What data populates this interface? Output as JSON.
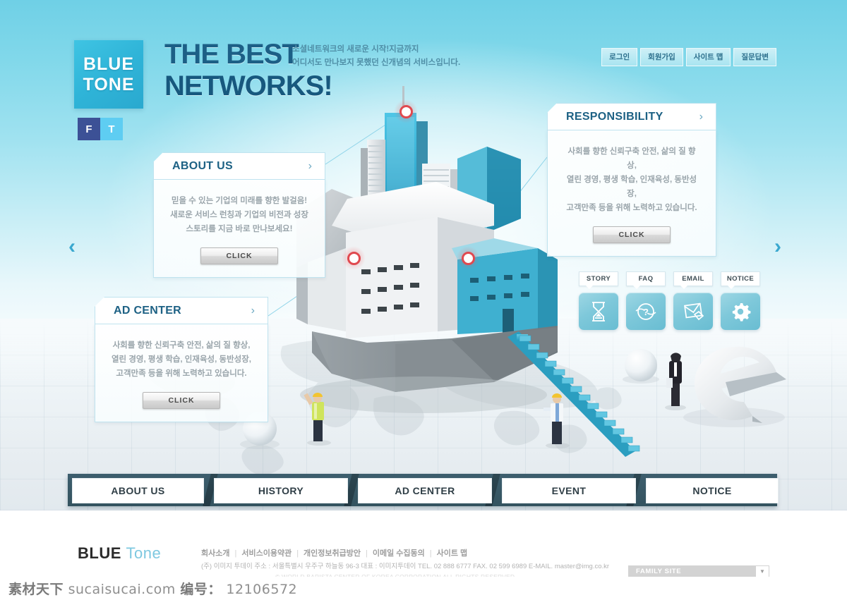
{
  "brand": {
    "logo_line1": "BLUE",
    "logo_line2": "TONE",
    "social": [
      {
        "name": "facebook",
        "label": "F"
      },
      {
        "name": "twitter",
        "label": "T"
      }
    ]
  },
  "hero": {
    "headline_line1": "THE BEST",
    "headline_line2": "NETWORKS!",
    "tagline_line1": "소셜네트워크의 새로운 시작!지금까지",
    "tagline_line2": "어디서도 만나보지 못했던 신개념의 서비스입니다."
  },
  "topnav": [
    {
      "label": "로그인"
    },
    {
      "label": "회원가입"
    },
    {
      "label": "사이트 맵"
    },
    {
      "label": "질문답변"
    }
  ],
  "cards": {
    "about": {
      "title": "ABOUT US",
      "chevron": "›",
      "line1": "믿을 수 있는 기업의 미래를 향한 발걸음!",
      "line2": "새로운 서비스 런칭과  기업의 비전과 성장",
      "line3": "스토리를 지금 바로 만나보세요!",
      "button": "CLICK"
    },
    "responsibility": {
      "title": "RESPONSIBILITY",
      "chevron": "›",
      "line1": "사회를 향한 신뢰구축 안전, 삶의 질 향상,",
      "line2": "열린 경영, 평생 학습, 인재육성, 동반성장,",
      "line3": "고객만족 등을 위해 노력하고 있습니다.",
      "button": "CLICK"
    },
    "adcenter": {
      "title": "AD CENTER",
      "chevron": "›",
      "line1": "사회를 향한 신뢰구축 안전, 삶의 질 향상,",
      "line2": "열린 경영, 평생 학습, 인재육성, 동반성장,",
      "line3": "고객만족 등을 위해 노력하고 있습니다.",
      "button": "CLICK"
    }
  },
  "carousel": {
    "prev": "‹",
    "next": "›"
  },
  "quickmenu": [
    {
      "label": "STORY",
      "icon": "hourglass-icon"
    },
    {
      "label": "FAQ",
      "icon": "question-circle-icon"
    },
    {
      "label": "EMAIL",
      "icon": "envelope-icon"
    },
    {
      "label": "NOTICE",
      "icon": "gear-icon"
    }
  ],
  "mainnav": [
    {
      "label": "ABOUT US"
    },
    {
      "label": "HISTORY"
    },
    {
      "label": "AD CENTER"
    },
    {
      "label": "EVENT"
    },
    {
      "label": "NOTICE"
    }
  ],
  "footer": {
    "logo_bold": "BLUE",
    "logo_light": "Tone",
    "links": [
      {
        "label": "회사소개"
      },
      {
        "label": "서비스이용약관"
      },
      {
        "label": "개인정보취급방안"
      },
      {
        "label": "이메일 수집동의"
      },
      {
        "label": "사이트 맵"
      }
    ],
    "separator": "|",
    "address": "(주) 이미지 투데이   주소 : 서울특별시 우주구 하늘동 96-3   대표 : 이미지투데이  TEL. 02 888 6777  FAX. 02 599 6989 E-MAIL. master@img.co.kr",
    "copyright": "© WORLD BARISTA CENTER OF KOREA CORPORATION.ALL RIGHTS RESERVED.",
    "family_site": "FAMILY SITE",
    "family_arrow": "▼"
  },
  "watermark": {
    "site_cn": "素材天下",
    "site_url": "sucaisucai.com",
    "id_label": "编号：",
    "id_value": "12106572"
  },
  "colors": {
    "sky_top": "#6fd0e6",
    "accent_blue": "#2fb4d8",
    "headline": "#1c5f86",
    "nav_plate": "#3d5e6e",
    "hotspot_red": "#e0494f",
    "facebook": "#3c5196",
    "twitter": "#5ecdf2"
  }
}
